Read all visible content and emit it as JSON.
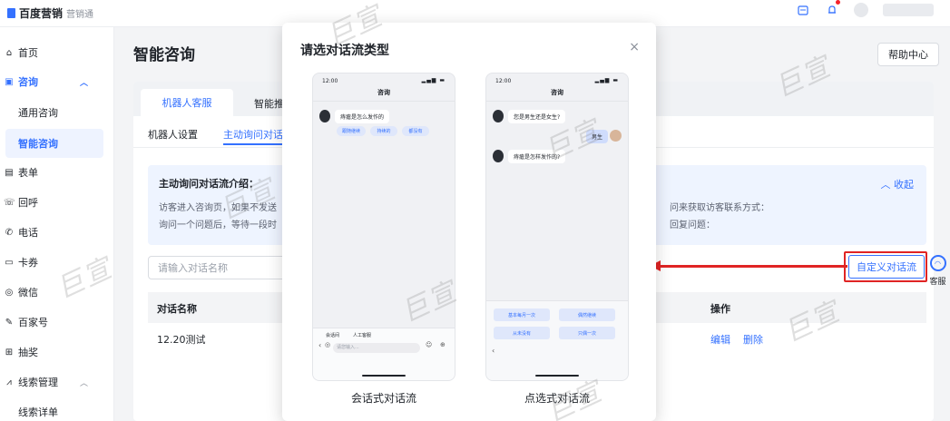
{
  "topbar": {
    "brand": "百度营销",
    "brand_sub": "营销通"
  },
  "sidebar": {
    "items": [
      {
        "label": "首页",
        "icon": "home-icon"
      },
      {
        "label": "咨询",
        "icon": "chat-icon",
        "expanded": true
      },
      {
        "label": "通用咨询"
      },
      {
        "label": "智能咨询",
        "active": true
      },
      {
        "label": "表单",
        "icon": "form-icon"
      },
      {
        "label": "回呼",
        "icon": "callback-icon"
      },
      {
        "label": "电话",
        "icon": "phone-icon"
      },
      {
        "label": "卡券",
        "icon": "coupon-icon"
      },
      {
        "label": "微信",
        "icon": "wechat-icon"
      },
      {
        "label": "百家号",
        "icon": "baijiahao-icon"
      },
      {
        "label": "抽奖",
        "icon": "lottery-icon"
      },
      {
        "label": "线索管理",
        "icon": "leads-icon",
        "expanded": true
      },
      {
        "label": "线索详单"
      }
    ]
  },
  "main": {
    "title": "智能咨询",
    "help_button": "帮助中心",
    "tabs": [
      "机器人客服",
      "智能推荐"
    ],
    "subtabs": [
      "机器人设置",
      "主动询问对话流"
    ],
    "intro": {
      "title": "主动询问对话流介绍：",
      "line1_left": "访客进入咨询页，如果不发送",
      "line1_right": "问来获取访客联系方式：",
      "line2_left": "询问一个问题后，等待一段时",
      "line2_right": "回复问题：",
      "collapse": "收起"
    },
    "search_placeholder": "请输入对话名称",
    "custom_button": "自定义对话流",
    "table": {
      "columns": [
        "对话名称",
        "操作"
      ],
      "rows": [
        {
          "name": "12.20测试",
          "ops": [
            "编辑",
            "删除"
          ]
        }
      ]
    }
  },
  "float": {
    "label": "客服"
  },
  "modal": {
    "title": "请选对话流类型",
    "close": "×",
    "left_phone": {
      "time": "12:00",
      "header": "咨询",
      "agent_msg": "痔瘡是怎么发作的",
      "chips": [
        "跟随继续",
        "持续的",
        "都没有"
      ],
      "bottom_tabs": [
        "会话间",
        "人工客服"
      ],
      "input_placeholder": "请您输入...",
      "caption": "会话式对话流"
    },
    "right_phone": {
      "time": "12:00",
      "header": "咨询",
      "agent_msg1": "您是男生还是女生?",
      "user_msg": "男生",
      "agent_msg2": "痔瘡是怎样发作的?",
      "options": [
        "基本每月一次",
        "偶然继续",
        "从未没有",
        "只偶一次"
      ],
      "caption": "点选式对话流"
    }
  },
  "watermark": "巨宣",
  "colors": {
    "accent": "#3471ff",
    "highlight": "#e02424"
  }
}
